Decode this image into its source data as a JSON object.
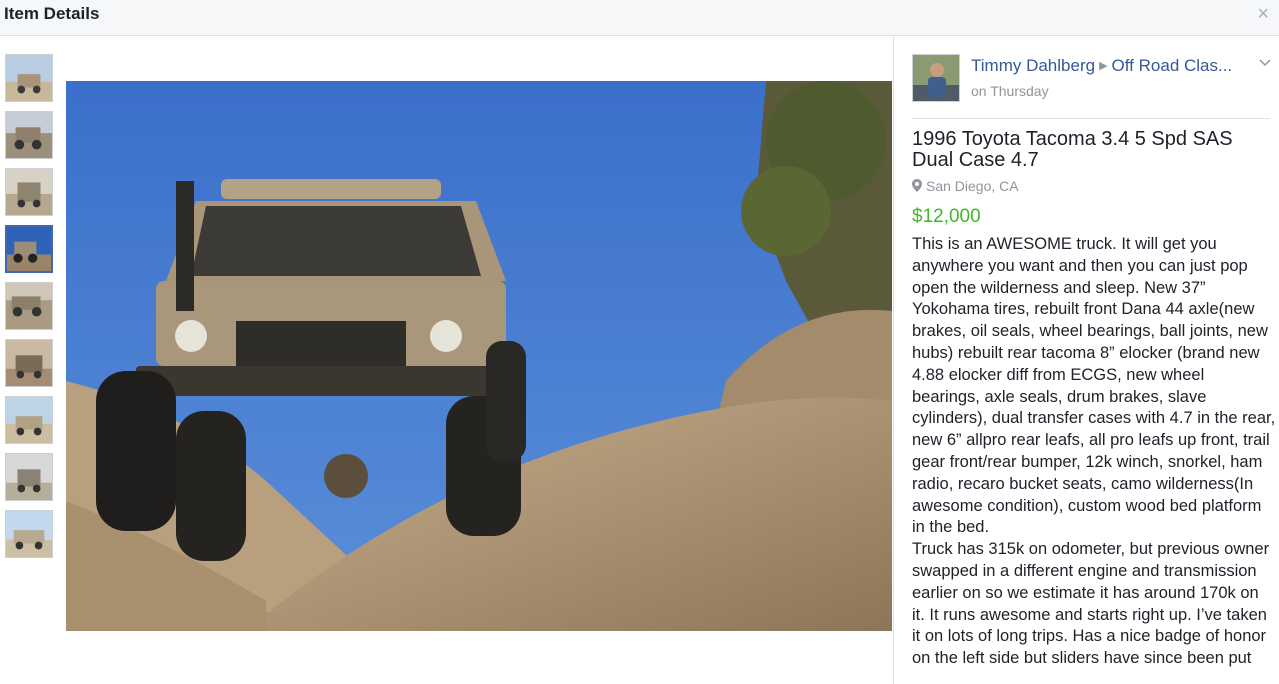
{
  "header": {
    "title": "Item Details",
    "close_label": "×"
  },
  "post": {
    "author": "Timmy Dahlberg",
    "separator": "▶",
    "group": "Off Road Clas...",
    "time": "on Thursday"
  },
  "listing": {
    "title": "1996 Toyota Tacoma 3.4 5 Spd SAS Dual Case 4.7",
    "location": "San Diego, CA",
    "price": "$12,000",
    "description": [
      "This is an AWESOME truck. It will get you anywhere you want and then you can just pop open the wilderness and sleep. New 37” Yokohama tires, rebuilt front Dana 44 axle(new brakes, oil seals, wheel bearings, ball joints, new hubs) rebuilt rear tacoma 8” elocker (brand new 4.88 elocker diff from ECGS, new wheel bearings, axle seals, drum brakes, slave cylinders), dual transfer cases with 4.7 in the rear, new 6” allpro rear leafs, all pro leafs up front, trail gear front/rear bumper, 12k winch, snorkel, ham radio, recaro bucket seats, camo wilderness(In awesome condition), custom wood bed platform in the bed.",
      "Truck has 315k on odometer, but previous owner swapped in a different engine and transmission earlier on so we estimate it has around 170k on it. It runs awesome and starts right up. I’ve taken it on lots of long trips. Has a nice badge of honor on the left side but sliders have since been put"
    ]
  },
  "thumbnails": {
    "count": 9,
    "selected_index": 3
  },
  "colors": {
    "link": "#365899",
    "price": "#42b72a",
    "selected_border": "#4267b2"
  },
  "icons": {
    "close": "close-icon",
    "location": "location-pin-icon",
    "chevron": "chevron-down-icon"
  }
}
